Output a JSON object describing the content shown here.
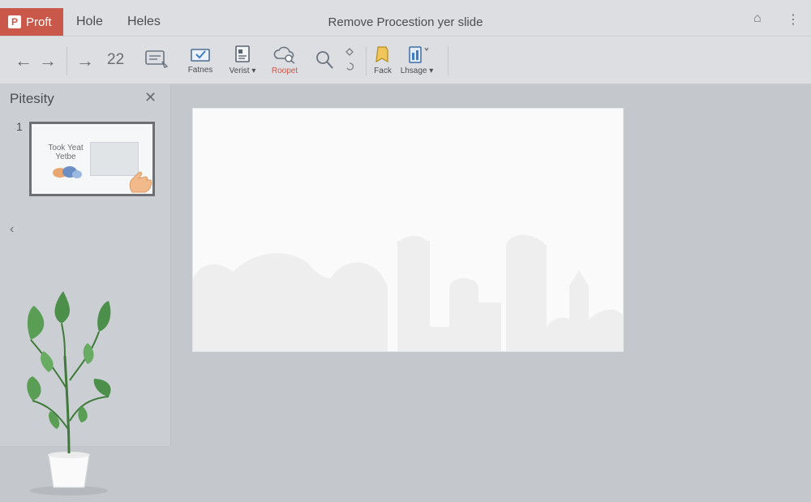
{
  "titlebar": {
    "app_label": "Proft",
    "menu": [
      "Hole",
      "Heles"
    ],
    "doc_title": "Remove Procestion yer slide"
  },
  "toolbar": {
    "page_number": "22",
    "tools": [
      {
        "label": "",
        "icon": "comments-icon"
      },
      {
        "label": "Fatnes",
        "icon": "check-frame-icon"
      },
      {
        "label": "Verist",
        "icon": "document-icon",
        "dropdown": true
      },
      {
        "label": "Roopet",
        "icon": "cloud-search-icon",
        "highlight": true
      },
      {
        "label": "",
        "icon": "magnifier-icon"
      },
      {
        "label": "Fack",
        "icon": "bookmark-icon"
      },
      {
        "label": "Lhsage",
        "icon": "chart-icon",
        "dropdown": true
      }
    ]
  },
  "sidebar": {
    "title": "Pitesity",
    "thumb_number": "1",
    "thumb_title": "Took Yeat Yetbe"
  },
  "colors": {
    "accent": "#c9574a",
    "panel": "#dcdee1",
    "canvas": "#c4c8cc"
  }
}
